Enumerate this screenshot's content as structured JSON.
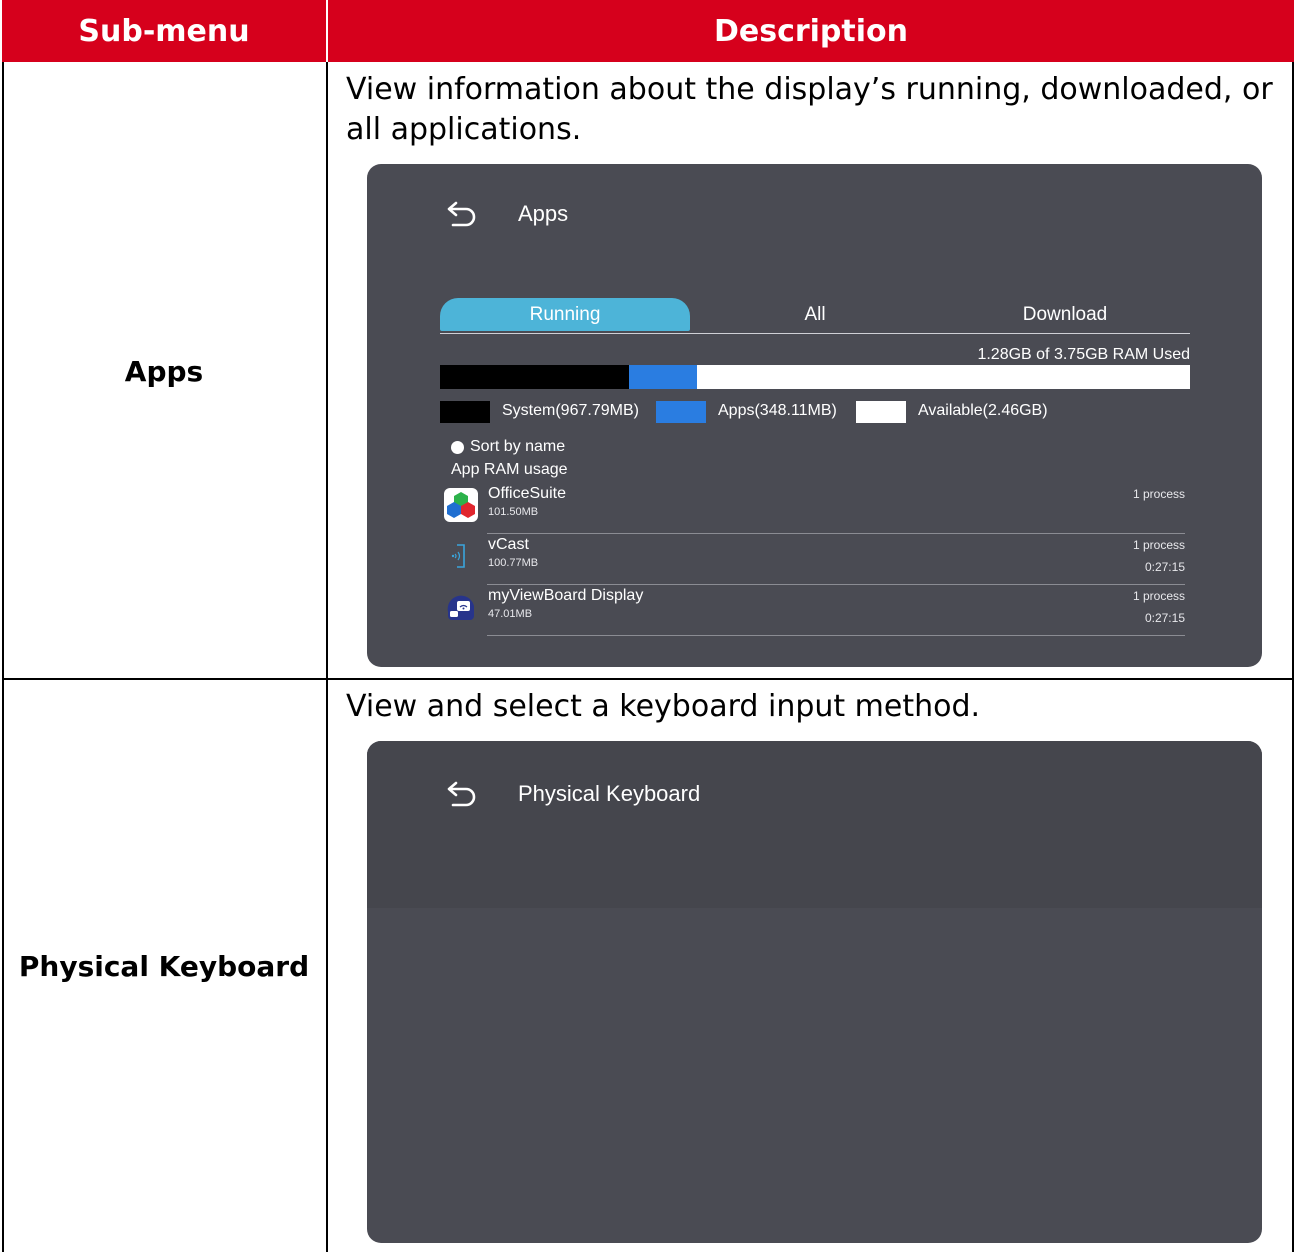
{
  "table": {
    "headers": [
      "Sub-menu",
      "Description"
    ],
    "rows": [
      {
        "submenu": "Apps",
        "description": "View information about the display’s running, downloaded, or all applications.",
        "screen": {
          "title": "Apps",
          "tabs": [
            {
              "label": "Running",
              "active": true
            },
            {
              "label": "All",
              "active": false
            },
            {
              "label": "Download",
              "active": false
            }
          ],
          "ram_used_text": "1.28GB of 3.75GB RAM Used",
          "ram": {
            "total_gb": 3.75,
            "system_fraction": 0.2518,
            "apps_fraction": 0.0906
          },
          "legend": [
            {
              "label": "System(967.79MB)",
              "color": "#000000"
            },
            {
              "label": "Apps(348.11MB)",
              "color": "#2a7de1"
            },
            {
              "label": "Available(2.46GB)",
              "color": "#ffffff"
            }
          ],
          "sort_label": "Sort by name",
          "usage_label": "App RAM usage",
          "apps": [
            {
              "name": "OfficeSuite",
              "size": "101.50MB",
              "processes": "1 process",
              "time": "",
              "icon": "officesuite-icon"
            },
            {
              "name": "vCast",
              "size": "100.77MB",
              "processes": "1 process",
              "time": "0:27:15",
              "icon": "vcast-icon"
            },
            {
              "name": "myViewBoard Display",
              "size": "47.01MB",
              "processes": "1 process",
              "time": "0:27:15",
              "icon": "myviewboard-display-icon"
            }
          ]
        }
      },
      {
        "submenu": "Physical Keyboard",
        "description": "View and select a keyboard input method.",
        "screen": {
          "title": "Physical Keyboard"
        }
      }
    ]
  },
  "colors": {
    "header_bg": "#d6001c",
    "panel_bg": "#4a4b53",
    "tab_active": "#4db4d8",
    "apps_segment": "#2a7de1"
  }
}
